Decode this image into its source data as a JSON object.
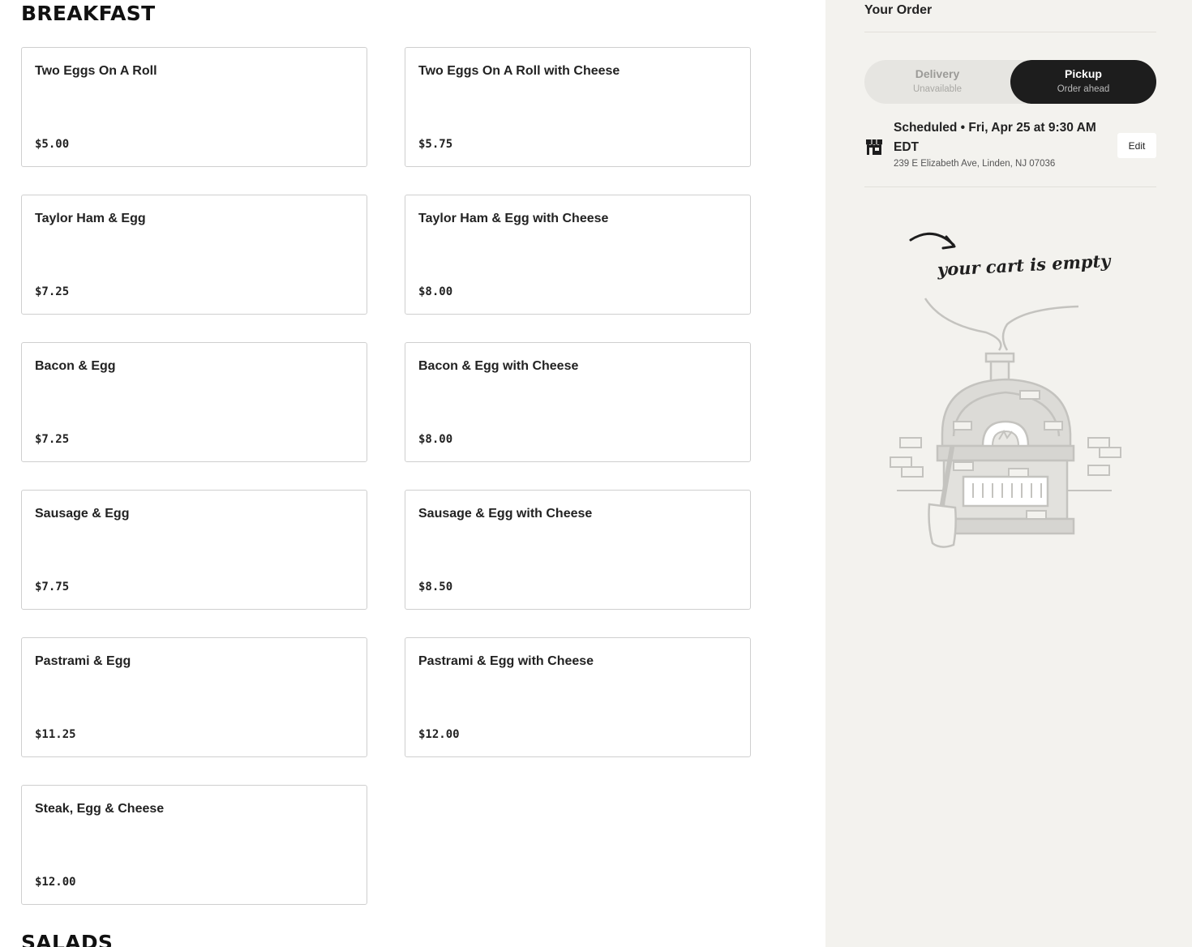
{
  "menu": {
    "sections": [
      {
        "title": "BREAKFAST"
      },
      {
        "title": "SALADS"
      }
    ],
    "items": [
      {
        "name": "Two Eggs On A Roll",
        "price": "$5.00"
      },
      {
        "name": "Two Eggs On A Roll with Cheese",
        "price": "$5.75"
      },
      {
        "name": "Taylor Ham & Egg",
        "price": "$7.25"
      },
      {
        "name": "Taylor Ham & Egg with Cheese",
        "price": "$8.00"
      },
      {
        "name": "Bacon & Egg",
        "price": "$7.25"
      },
      {
        "name": "Bacon & Egg with Cheese",
        "price": "$8.00"
      },
      {
        "name": "Sausage & Egg",
        "price": "$7.75"
      },
      {
        "name": "Sausage & Egg with Cheese",
        "price": "$8.50"
      },
      {
        "name": "Pastrami & Egg",
        "price": "$11.25"
      },
      {
        "name": "Pastrami & Egg with Cheese",
        "price": "$12.00"
      },
      {
        "name": "Steak, Egg & Cheese",
        "price": "$12.00"
      }
    ]
  },
  "order": {
    "title": "Your Order",
    "modes": [
      {
        "label": "Delivery",
        "sub": "Unavailable",
        "selected": false
      },
      {
        "label": "Pickup",
        "sub": "Order ahead",
        "selected": true
      }
    ],
    "schedule": {
      "icon": "store-icon",
      "text": "Scheduled • Fri, Apr 25 at 9:30 AM EDT",
      "address": "239 E Elizabeth Ave, Linden, NJ 07036",
      "edit_label": "Edit"
    },
    "empty_message": "your cart is empty",
    "illustration_icon": "pizza-oven-illustration"
  },
  "colors": {
    "page_bg": "#ffffff",
    "sidebar_bg": "#f3f2ee",
    "toggle_selected": "#1d1d1d",
    "card_border": "#cfcfcf"
  }
}
